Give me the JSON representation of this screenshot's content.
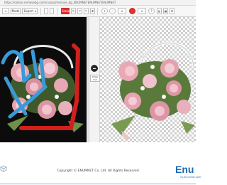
{
  "window": {
    "url": "https://online.removebg.com/cutout/remove_bg_ENUMNETENUMNETENUMNET"
  },
  "toolbar": {
    "mode_label": "Mode",
    "mode_value": "Expert",
    "buttons": [
      "Erase",
      "Restore",
      "Undo",
      "Redo",
      "Zoom In",
      "Zoom Out"
    ],
    "accent_color": "#e0332e"
  },
  "divider": {
    "label": "Drag Cut"
  },
  "footer": {
    "copyright": "Copyright © ENUMNET Co. Ltd. All Rights Reserved",
    "brand": "Enu",
    "brand_sub": "ny.enumnet.com",
    "brand_color": "#1d68b3"
  }
}
